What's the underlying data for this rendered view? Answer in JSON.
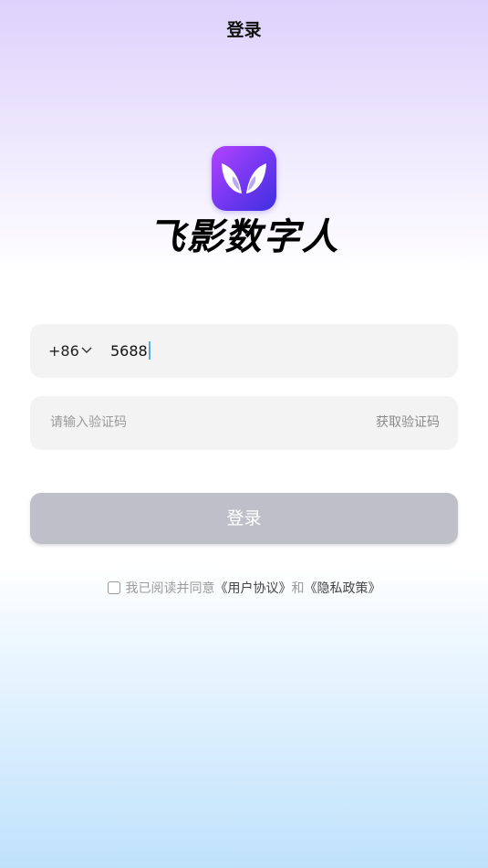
{
  "header": {
    "title": "登录"
  },
  "brand": {
    "name": "飞影数字人",
    "logo_icon": "butterfly-logo-icon"
  },
  "phone": {
    "country_code": "+86",
    "value": "5688"
  },
  "verification": {
    "placeholder": "请输入验证码",
    "get_code_label": "获取验证码"
  },
  "login_button": {
    "label": "登录"
  },
  "agreement": {
    "prefix": "我已阅读并同意",
    "user_agreement": "《用户协议》",
    "conjunction": "和",
    "privacy_policy": "《隐私政策》"
  },
  "colors": {
    "accent_purple": "#7c39f3",
    "button_disabled": "#bfbfc9",
    "caret": "#5aa8e6"
  }
}
